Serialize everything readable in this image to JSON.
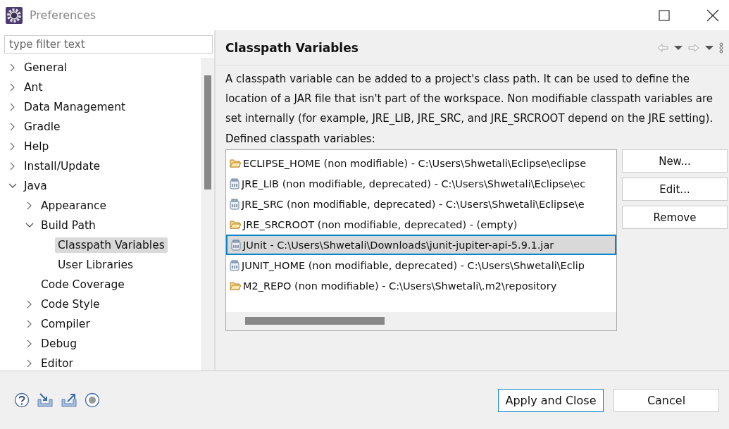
{
  "window": {
    "title": "Preferences"
  },
  "filter": {
    "placeholder": "type filter text"
  },
  "tree": [
    {
      "label": "General",
      "expanded": false,
      "selected": false
    },
    {
      "label": "Ant",
      "expanded": false,
      "selected": false
    },
    {
      "label": "Data Management",
      "expanded": false,
      "selected": false
    },
    {
      "label": "Gradle",
      "expanded": false,
      "selected": false
    },
    {
      "label": "Help",
      "expanded": false,
      "selected": false
    },
    {
      "label": "Install/Update",
      "expanded": false,
      "selected": false
    },
    {
      "label": "Java",
      "expanded": true,
      "selected": false,
      "children": [
        {
          "label": "Appearance",
          "expanded": false,
          "selected": false
        },
        {
          "label": "Build Path",
          "expanded": true,
          "selected": false,
          "children": [
            {
              "label": "Classpath Variables",
              "selected": true
            },
            {
              "label": "User Libraries",
              "selected": false
            }
          ]
        },
        {
          "label": "Code Coverage",
          "selected": false
        },
        {
          "label": "Code Style",
          "expanded": false,
          "selected": false
        },
        {
          "label": "Compiler",
          "expanded": false,
          "selected": false
        },
        {
          "label": "Debug",
          "expanded": false,
          "selected": false
        },
        {
          "label": "Editor",
          "expanded": false,
          "selected": false
        }
      ]
    }
  ],
  "page": {
    "title": "Classpath Variables",
    "description": "A classpath variable can be added to a project's class path. It can be used to define the location of a JAR file that isn't part of the workspace. Non modifiable classpath variables are set internally (for example, JRE_LIB, JRE_SRC, and JRE_SRCROOT depend on the JRE setting).",
    "list_label": "Defined classpath variables:"
  },
  "variables": [
    {
      "kind": "folder",
      "text": "ECLIPSE_HOME (non modifiable) - C:\\Users\\Shwetali\\Eclipse\\eclipse",
      "selected": false
    },
    {
      "kind": "jar",
      "text": "JRE_LIB (non modifiable, deprecated) - C:\\Users\\Shwetali\\Eclipse\\ec",
      "selected": false
    },
    {
      "kind": "jar",
      "text": "JRE_SRC (non modifiable, deprecated) - C:\\Users\\Shwetali\\Eclipse\\e",
      "selected": false
    },
    {
      "kind": "folder",
      "text": "JRE_SRCROOT (non modifiable, deprecated) - (empty)",
      "selected": false
    },
    {
      "kind": "jar",
      "text": "JUnit - C:\\Users\\Shwetali\\Downloads\\junit-jupiter-api-5.9.1.jar",
      "selected": true
    },
    {
      "kind": "jar",
      "text": "JUNIT_HOME (non modifiable, deprecated) - C:\\Users\\Shwetali\\Eclip",
      "selected": false
    },
    {
      "kind": "folder",
      "text": "M2_REPO (non modifiable) - C:\\Users\\Shwetali\\.m2\\repository",
      "selected": false
    }
  ],
  "side_buttons": [
    "New...",
    "Edit...",
    "Remove"
  ],
  "buttons": [
    {
      "label": "Apply and Close",
      "kind": "primary"
    },
    {
      "label": "Cancel",
      "kind": "normal"
    }
  ]
}
